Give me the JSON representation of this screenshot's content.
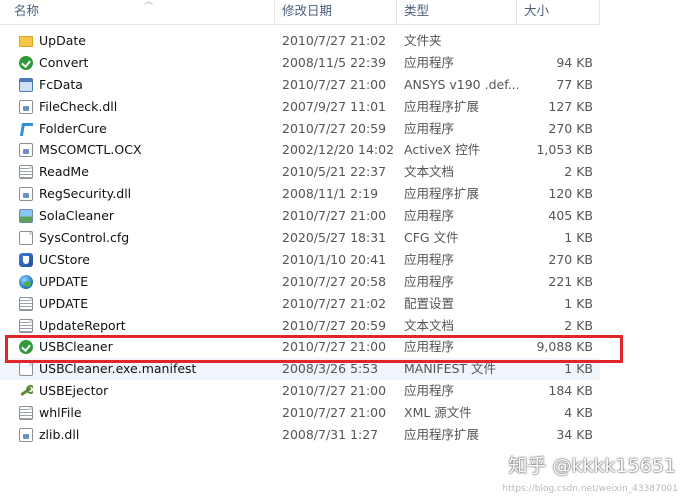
{
  "columns": {
    "name": "名称",
    "modified": "修改日期",
    "type": "类型",
    "size": "大小"
  },
  "files": [
    {
      "name": "UpDate",
      "modified": "2010/7/27 21:02",
      "type": "文件夹",
      "size": "",
      "icon": "folder-icon"
    },
    {
      "name": "Convert",
      "modified": "2008/11/5 22:39",
      "type": "应用程序",
      "size": "94 KB",
      "icon": "green-app-icon"
    },
    {
      "name": "FcData",
      "modified": "2010/7/27 21:00",
      "type": "ANSYS v190 .def...",
      "size": "77 KB",
      "icon": "app-window-icon"
    },
    {
      "name": "FileCheck.dll",
      "modified": "2007/9/27 11:01",
      "type": "应用程序扩展",
      "size": "127 KB",
      "icon": "dll-icon"
    },
    {
      "name": "FolderCure",
      "modified": "2010/7/27 20:59",
      "type": "应用程序",
      "size": "270 KB",
      "icon": "folder-cure-icon"
    },
    {
      "name": "MSCOMCTL.OCX",
      "modified": "2002/12/20 14:02",
      "type": "ActiveX 控件",
      "size": "1,053 KB",
      "icon": "dll-icon"
    },
    {
      "name": "ReadMe",
      "modified": "2010/5/21 22:37",
      "type": "文本文档",
      "size": "2 KB",
      "icon": "text-document-icon"
    },
    {
      "name": "RegSecurity.dll",
      "modified": "2008/11/1 2:19",
      "type": "应用程序扩展",
      "size": "120 KB",
      "icon": "dll-icon"
    },
    {
      "name": "SolaCleaner",
      "modified": "2010/7/27 21:00",
      "type": "应用程序",
      "size": "405 KB",
      "icon": "photo-app-icon"
    },
    {
      "name": "SysControl.cfg",
      "modified": "2020/5/27 18:31",
      "type": "CFG 文件",
      "size": "1 KB",
      "icon": "blank-document-icon"
    },
    {
      "name": "UCStore",
      "modified": "2010/1/10 20:41",
      "type": "应用程序",
      "size": "270 KB",
      "icon": "blue-shield-icon"
    },
    {
      "name": "UPDATE",
      "modified": "2010/7/27 20:58",
      "type": "应用程序",
      "size": "221 KB",
      "icon": "globe-icon"
    },
    {
      "name": "UPDATE",
      "modified": "2010/7/27 21:02",
      "type": "配置设置",
      "size": "1 KB",
      "icon": "settings-document-icon"
    },
    {
      "name": "UpdateReport",
      "modified": "2010/7/27 20:59",
      "type": "文本文档",
      "size": "2 KB",
      "icon": "text-document-icon"
    },
    {
      "name": "USBCleaner",
      "modified": "2010/7/27 21:00",
      "type": "应用程序",
      "size": "9,088 KB",
      "icon": "green-app-icon",
      "highlighted": true
    },
    {
      "name": "USBCleaner.exe.manifest",
      "modified": "2008/3/26 5:53",
      "type": "MANIFEST 文件",
      "size": "1 KB",
      "icon": "blank-document-icon"
    },
    {
      "name": "USBEjector",
      "modified": "2010/7/27 21:00",
      "type": "应用程序",
      "size": "184 KB",
      "icon": "wrench-icon"
    },
    {
      "name": "whlFile",
      "modified": "2010/7/27 21:00",
      "type": "XML 源文件",
      "size": "4 KB",
      "icon": "text-document-icon"
    },
    {
      "name": "zlib.dll",
      "modified": "2008/7/31 1:27",
      "type": "应用程序扩展",
      "size": "34 KB",
      "icon": "dll-icon"
    }
  ],
  "watermark": {
    "text": "知乎 @kkkk15651",
    "url": "https://blog.csdn.net/weixin_43387001"
  },
  "colors": {
    "highlight_border": "#e0262b",
    "header_text": "#4c607a"
  }
}
